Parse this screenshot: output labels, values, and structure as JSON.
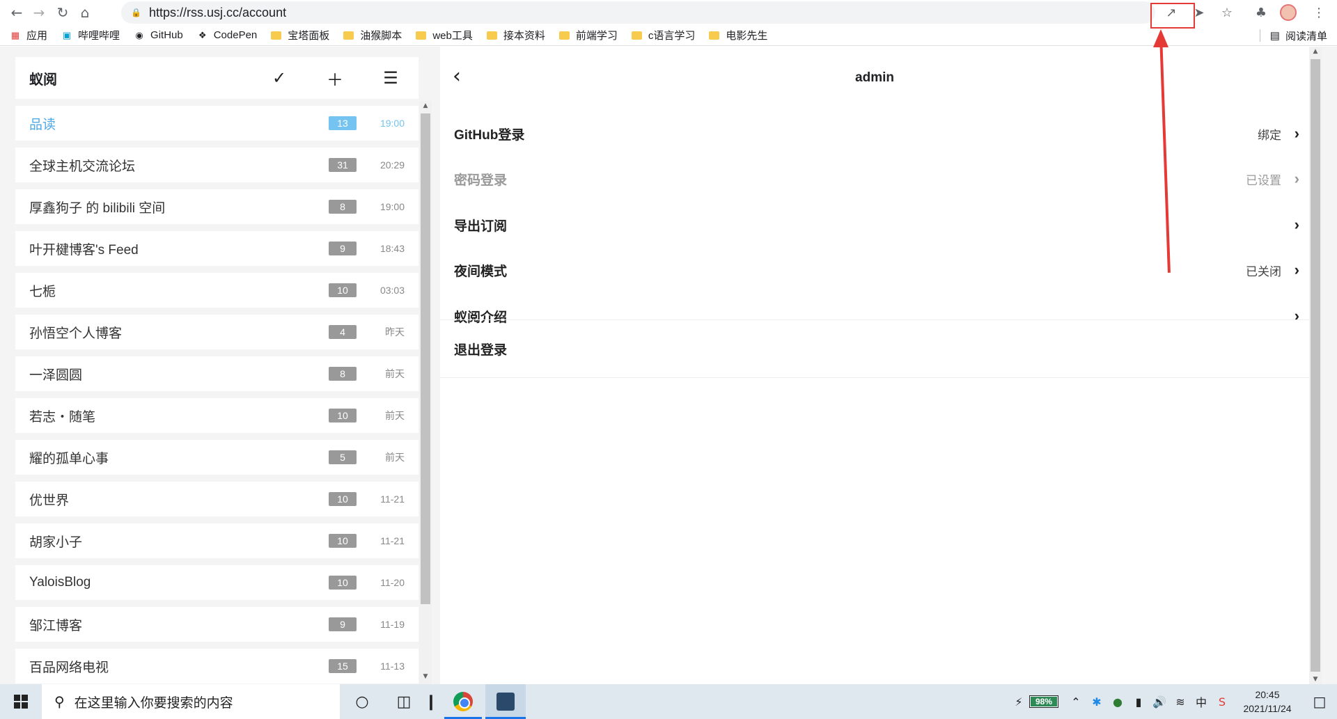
{
  "browser": {
    "url": "https://rss.usj.cc/account",
    "bookmarks": [
      {
        "label": "应用",
        "icon": "apps-grid-icon"
      },
      {
        "label": "哔哩哔哩",
        "icon": "bilibili-icon"
      },
      {
        "label": "GitHub",
        "icon": "github-icon"
      },
      {
        "label": "CodePen",
        "icon": "codepen-icon"
      },
      {
        "label": "宝塔面板",
        "icon": "folder-icon"
      },
      {
        "label": "油猴脚本",
        "icon": "folder-icon"
      },
      {
        "label": "web工具",
        "icon": "folder-icon"
      },
      {
        "label": "接本资料",
        "icon": "folder-icon"
      },
      {
        "label": "前端学习",
        "icon": "folder-icon"
      },
      {
        "label": "c语言学习",
        "icon": "folder-icon"
      },
      {
        "label": "电影先生",
        "icon": "folder-icon"
      }
    ],
    "reading_list": "阅读清单"
  },
  "sidebar": {
    "title": "蚁阅",
    "feeds": [
      {
        "name": "品读",
        "count": "13",
        "time": "19:00",
        "active": true
      },
      {
        "name": "全球主机交流论坛",
        "count": "31",
        "time": "20:29"
      },
      {
        "name": "厚鑫狗子 的 bilibili 空间",
        "count": "8",
        "time": "19:00"
      },
      {
        "name": "叶开楗博客's Feed",
        "count": "9",
        "time": "18:43"
      },
      {
        "name": "七栀",
        "count": "10",
        "time": "03:03"
      },
      {
        "name": "孙悟空个人博客",
        "count": "4",
        "time": "昨天"
      },
      {
        "name": "一泽圆圆",
        "count": "8",
        "time": "前天"
      },
      {
        "name": "若志・随笔",
        "count": "10",
        "time": "前天"
      },
      {
        "name": "耀的孤单心事",
        "count": "5",
        "time": "前天"
      },
      {
        "name": "优世界",
        "count": "10",
        "time": "11-21"
      },
      {
        "name": "胡家小子",
        "count": "10",
        "time": "11-21"
      },
      {
        "name": "YaloisBlog",
        "count": "10",
        "time": "11-20"
      },
      {
        "name": "邹江博客",
        "count": "9",
        "time": "11-19"
      },
      {
        "name": "百品网络电视",
        "count": "15",
        "time": "11-13"
      }
    ]
  },
  "account": {
    "title": "admin",
    "settings": [
      {
        "label": "GitHub登录",
        "value": "绑定"
      },
      {
        "label": "密码登录",
        "value": "已设置"
      },
      {
        "label": "导出订阅",
        "value": ""
      },
      {
        "label": "夜间模式",
        "value": "已关闭"
      },
      {
        "label": "蚁阅介绍",
        "value": ""
      }
    ],
    "logout": "退出登录"
  },
  "taskbar": {
    "search_placeholder": "在这里输入你要搜索的内容",
    "battery": "98%",
    "time": "20:45",
    "date": "2021/11/24"
  },
  "colors": {
    "accent": "#4fa9e5",
    "annotation": "#e53935"
  }
}
